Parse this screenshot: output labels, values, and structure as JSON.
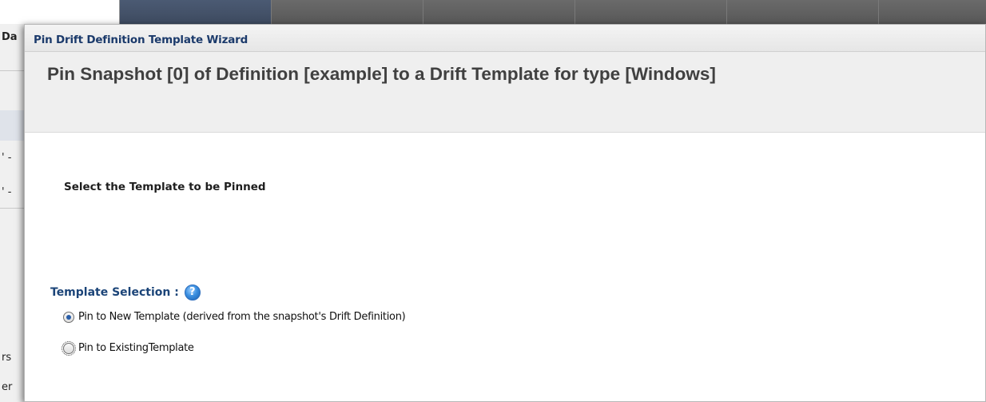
{
  "background": {
    "left_fragments": [
      "Da",
      "' -",
      "' -",
      "rs",
      "er"
    ]
  },
  "dialog": {
    "title": "Pin Drift Definition Template Wizard",
    "header": "Pin Snapshot [0] of Definition [example] to a Drift Template for type [Windows]",
    "step_label": "Select the Template to be Pinned",
    "field_label": "Template Selection :",
    "help_icon": "help-icon",
    "options": [
      {
        "label": "Pin to New Template (derived from the snapshot's Drift Definition)",
        "selected": true
      },
      {
        "label": "Pin to ExistingTemplate",
        "selected": false
      }
    ]
  },
  "colors": {
    "title_text": "#1b3a6b",
    "field_label": "#1b4478",
    "header_bg": "#efefef"
  }
}
